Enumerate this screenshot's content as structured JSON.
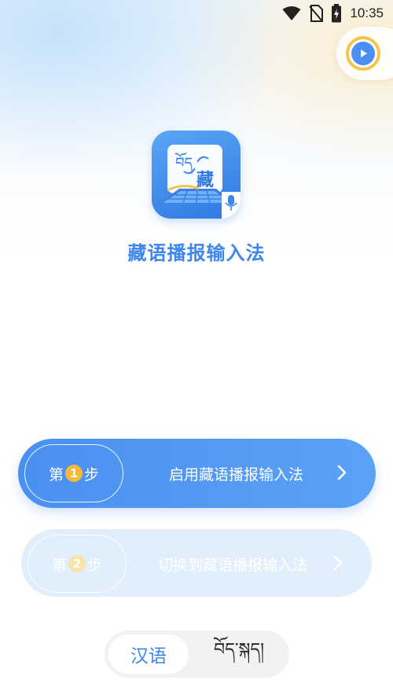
{
  "status_bar": {
    "time": "10:35",
    "icons": [
      "wifi-icon",
      "no-sim-icon",
      "battery-charging-icon"
    ]
  },
  "floating_button": {
    "icon": "play-icon",
    "accent": "#f5c44a",
    "fill": "#4a8ff1"
  },
  "app": {
    "icon_glyphs": {
      "tibetan": "བོད",
      "chinese": "藏"
    },
    "title": "藏语播报输入法"
  },
  "steps": [
    {
      "prefix": "第",
      "number": "1",
      "suffix": "步",
      "label": "启用藏语播报输入法",
      "enabled": true
    },
    {
      "prefix": "第",
      "number": "2",
      "suffix": "步",
      "label": "切换到藏语播报输入法",
      "enabled": false
    }
  ],
  "language_switch": {
    "options": [
      "汉语",
      "བོད་སྐད།"
    ],
    "selected": "汉语"
  },
  "colors": {
    "primary": "#4a90f0",
    "title": "#3d86ee",
    "badge": "#f7b93b",
    "disabled_bg": "#e1eefc"
  }
}
